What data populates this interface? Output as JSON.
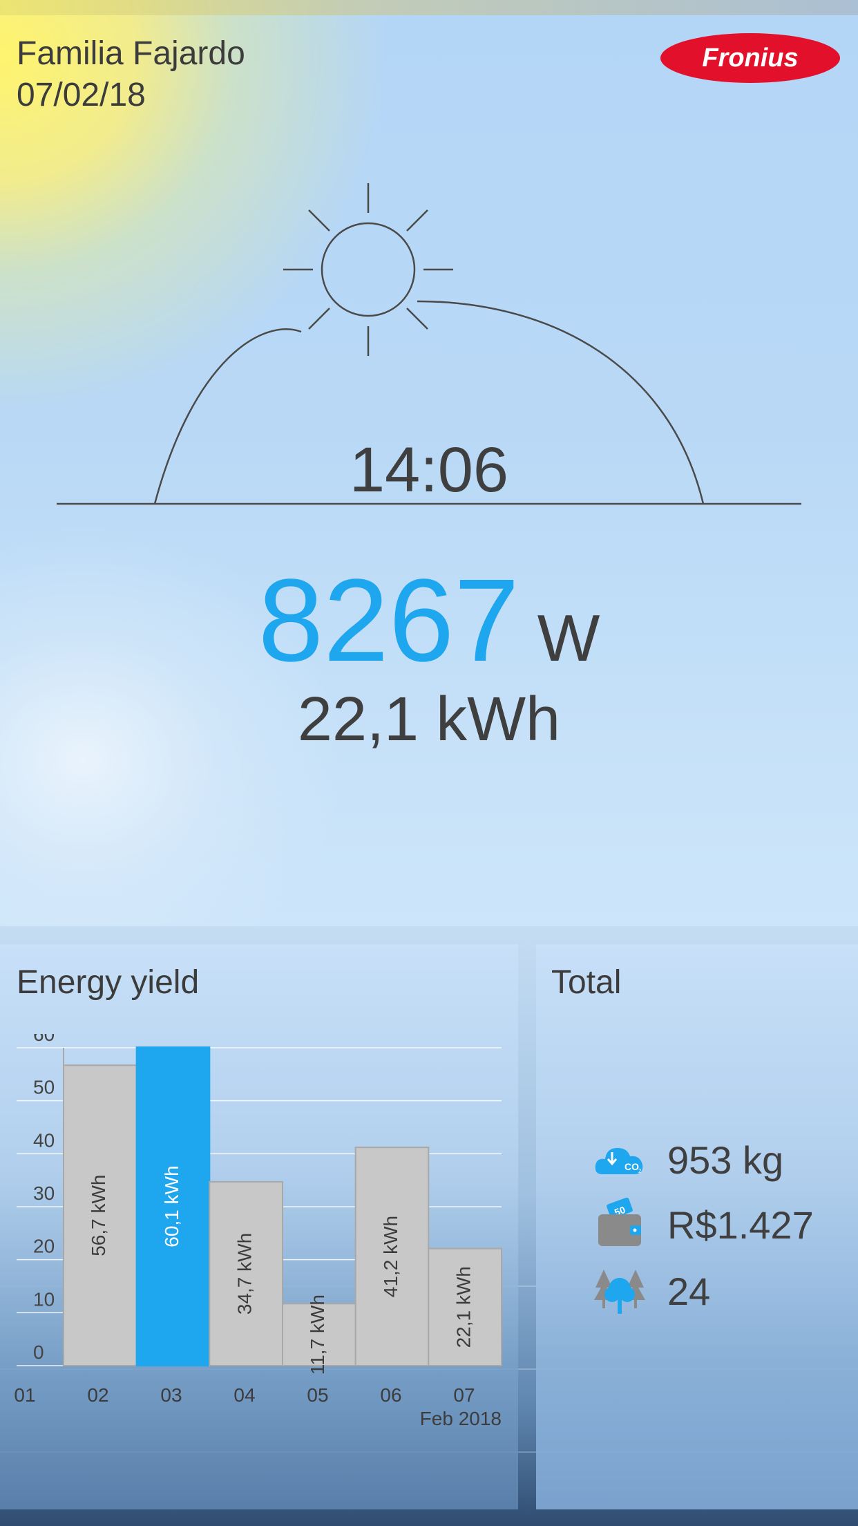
{
  "header": {
    "family_name": "Familia Fajardo",
    "date": "07/02/18",
    "brand": "Fronius"
  },
  "live": {
    "time": "14:06",
    "power_value": "8267",
    "power_unit": "W",
    "energy_today": "22,1 kWh"
  },
  "energy_yield": {
    "title": "Energy yield"
  },
  "chart_data": {
    "type": "bar",
    "title": "Energy yield",
    "categories": [
      "01",
      "02",
      "03",
      "04",
      "05",
      "06",
      "07"
    ],
    "values": [
      0,
      56.7,
      60.1,
      34.7,
      11.7,
      41.2,
      22.1
    ],
    "value_labels": [
      "",
      "56,7 kWh",
      "60,1 kWh",
      "34,7 kWh",
      "11,7 kWh",
      "41,2 kWh",
      "22,1 kWh"
    ],
    "highlight_category": "03",
    "ylim": [
      0,
      60
    ],
    "y_ticks": [
      "0",
      "10",
      "20",
      "30",
      "40",
      "50",
      "60"
    ],
    "period_label": "Feb 2018",
    "grid": true,
    "colors": {
      "bar": "#c8c8c8",
      "highlight": "#1ea6ee"
    }
  },
  "total": {
    "title": "Total",
    "co2": "953 kg",
    "money": "R$1.427",
    "trees": "24",
    "icons": [
      "co2-cloud-icon",
      "wallet-icon",
      "trees-icon"
    ]
  },
  "colors": {
    "accent": "#1ea6ee",
    "text": "#3f3f3f",
    "brand": "#e2102a"
  }
}
